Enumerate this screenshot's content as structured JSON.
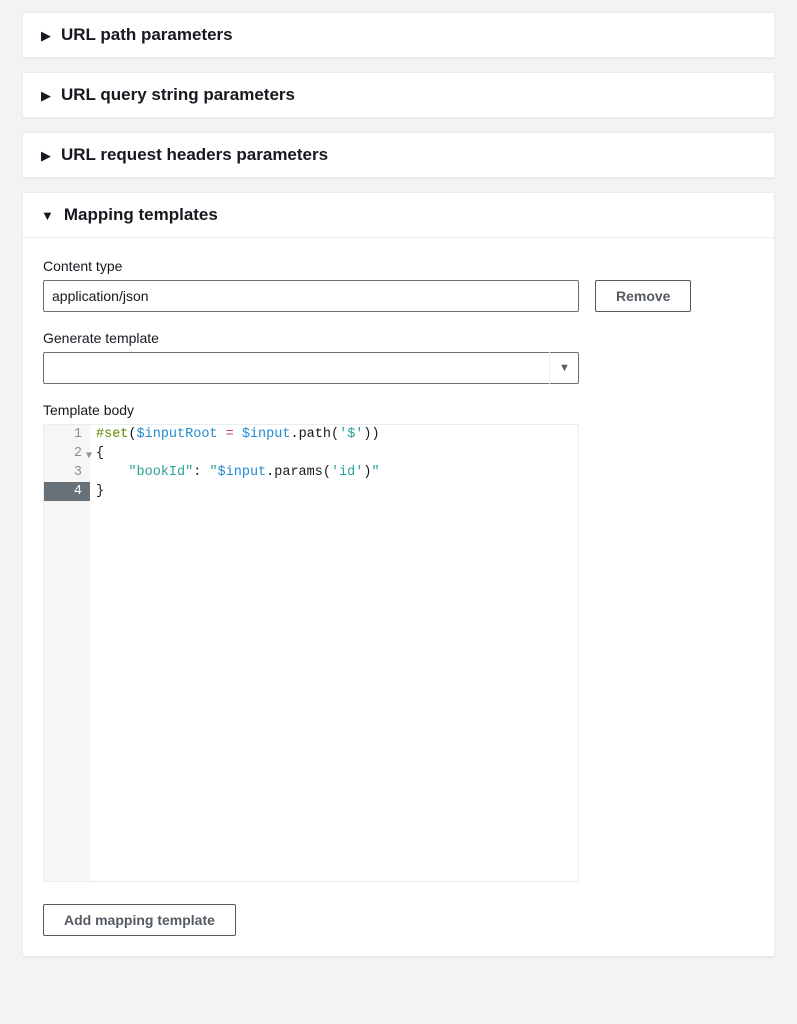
{
  "panels": {
    "path": {
      "title": "URL path parameters"
    },
    "query": {
      "title": "URL query string parameters"
    },
    "headers": {
      "title": "URL request headers parameters"
    },
    "mapping": {
      "title": "Mapping templates"
    }
  },
  "mapping": {
    "content_type_label": "Content type",
    "content_type_value": "application/json",
    "remove_label": "Remove",
    "generate_label": "Generate template",
    "generate_value": "",
    "template_body_label": "Template body",
    "code_lines": {
      "l1": "#set($inputRoot = $input.path('$'))",
      "l2": "{",
      "l3": "    \"bookId\": \"$input.params('id')\"",
      "l4": "}"
    },
    "line_numbers": {
      "n1": "1",
      "n2": "2",
      "n3": "3",
      "n4": "4"
    },
    "add_template_label": "Add mapping template"
  }
}
